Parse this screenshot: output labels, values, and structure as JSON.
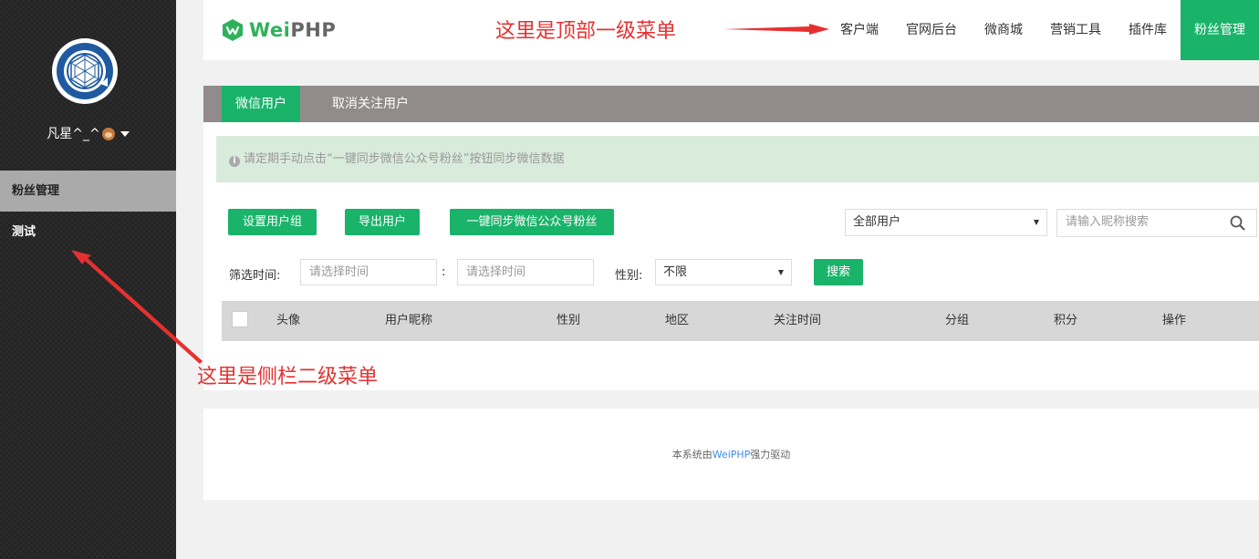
{
  "sidebar": {
    "user_name": "凡星^_^",
    "items": [
      {
        "label": "粉丝管理",
        "active": true
      },
      {
        "label": "测试",
        "active": false
      }
    ]
  },
  "header": {
    "logo_wei": "Wei",
    "logo_php": "PHP",
    "nav": [
      {
        "label": "客户端",
        "active": false
      },
      {
        "label": "官网后台",
        "active": false
      },
      {
        "label": "微商城",
        "active": false
      },
      {
        "label": "营销工具",
        "active": false
      },
      {
        "label": "插件库",
        "active": false
      },
      {
        "label": "粉丝管理",
        "active": true
      }
    ]
  },
  "annotations": {
    "top": "这里是顶部一级菜单",
    "side": "这里是侧栏二级菜单"
  },
  "tabs": [
    "微信用户",
    "取消关注用户"
  ],
  "alert": "请定期手动点击“一键同步微信公众号粉丝”按钮同步微信数据",
  "toolbar": {
    "set_group": "设置用户组",
    "export": "导出用户",
    "sync": "一键同步微信公众号粉丝",
    "user_filter": "全部用户",
    "search_placeholder": "请输入昵称搜索"
  },
  "filter": {
    "time_label": "筛选时间:",
    "start_placeholder": "请选择时间",
    "separator": ":",
    "end_placeholder": "请选择时间",
    "gender_label": "性别:",
    "gender_value": "不限",
    "search_button": "搜索"
  },
  "table": {
    "columns": [
      "头像",
      "用户昵称",
      "性别",
      "地区",
      "关注时间",
      "分组",
      "积分",
      "操作"
    ]
  },
  "footer": {
    "prefix": "本系统由",
    "brand": "WeiPHP",
    "suffix": "强力驱动"
  },
  "colors": {
    "accent": "#1ab36a",
    "annotation": "#e63030",
    "sidebar_bg": "#2b2b2b"
  }
}
